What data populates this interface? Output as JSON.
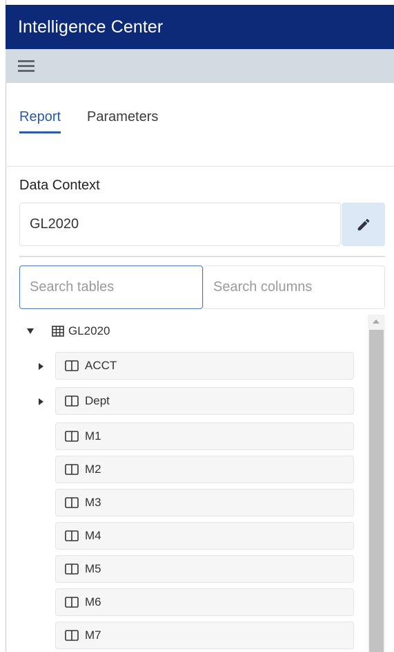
{
  "app": {
    "title": "Intelligence Center"
  },
  "toolbar": {
    "menu_icon": "hamburger-menu-icon"
  },
  "tabs": [
    {
      "label": "Report",
      "active": true
    },
    {
      "label": "Parameters",
      "active": false
    }
  ],
  "data_context": {
    "label": "Data Context",
    "value": "GL2020",
    "edit_icon": "pencil-icon"
  },
  "search": {
    "tables_placeholder": "Search tables",
    "columns_placeholder": "Search columns"
  },
  "tree": {
    "root": {
      "label": "GL2020",
      "icon": "table-grid-icon",
      "expanded": true
    },
    "items": [
      {
        "label": "ACCT",
        "expandable": true,
        "icon": "column-icon"
      },
      {
        "label": "Dept",
        "expandable": true,
        "icon": "column-icon"
      },
      {
        "label": "M1",
        "expandable": false,
        "icon": "column-icon"
      },
      {
        "label": "M2",
        "expandable": false,
        "icon": "column-icon"
      },
      {
        "label": "M3",
        "expandable": false,
        "icon": "column-icon"
      },
      {
        "label": "M4",
        "expandable": false,
        "icon": "column-icon"
      },
      {
        "label": "M5",
        "expandable": false,
        "icon": "column-icon"
      },
      {
        "label": "M6",
        "expandable": false,
        "icon": "column-icon"
      },
      {
        "label": "M7",
        "expandable": false,
        "icon": "column-icon"
      }
    ]
  },
  "colors": {
    "titlebar": "#0d2a78",
    "toolbar": "#d3dbe0",
    "accent": "#2a59a6",
    "edit_button_bg": "#dde8f6"
  }
}
